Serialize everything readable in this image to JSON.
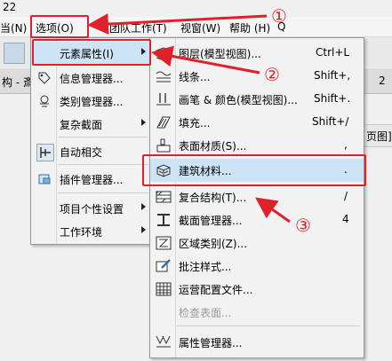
{
  "app": {
    "title_fragment": "22",
    "menubar": [
      {
        "label": "当(N)"
      },
      {
        "label": "选项(O)"
      },
      {
        "label": "团队工作(T)"
      },
      {
        "label": "视窗(W)"
      },
      {
        "label": "帮助 (H)"
      },
      {
        "label": "Q"
      }
    ],
    "tab_fragments": [
      "构 - 斎",
      "2"
    ],
    "right_pane_fragment": "页图]"
  },
  "options_menu": {
    "items": [
      {
        "label": "元素属性(I)",
        "icon": "element-properties-icon",
        "submenu": true,
        "highlighted": true
      },
      {
        "label": "信息管理器...",
        "icon": "tag-icon",
        "submenu": false
      },
      {
        "label": "类别管理器...",
        "icon": "layers-icon",
        "submenu": false
      },
      {
        "label": "复杂截面",
        "icon": "",
        "submenu": true
      },
      {
        "label": "自动相交",
        "icon": "intersect-icon",
        "submenu": false
      },
      {
        "label": "插件管理器...",
        "icon": "plugin-icon",
        "submenu": false
      },
      {
        "label": "项目个性设置",
        "icon": "",
        "submenu": true
      },
      {
        "label": "工作环境",
        "icon": "",
        "submenu": true
      }
    ]
  },
  "element_submenu": {
    "items": [
      {
        "label": "图层(模型视图)...",
        "shortcut": "Ctrl+L",
        "icon": "layers-stack-icon"
      },
      {
        "label": "线条...",
        "shortcut": "Shift+,",
        "icon": "line-type-icon"
      },
      {
        "label": "画笔 & 颜色(模型视图)...",
        "shortcut": "Shift+.",
        "icon": "pen-color-icon"
      },
      {
        "label": "填充...",
        "shortcut": "Shift+/",
        "icon": "fill-icon"
      },
      {
        "label": "表面材质(S)...",
        "shortcut": ",",
        "icon": "surface-icon"
      },
      {
        "label": "建筑材料...",
        "shortcut": ".",
        "icon": "building-material-icon",
        "highlighted": true
      },
      {
        "label": "复合结构(T)...",
        "shortcut": "/",
        "icon": "composite-icon"
      },
      {
        "label": "截面管理器...",
        "shortcut": "4",
        "icon": "profile-icon"
      },
      {
        "label": "区域类别(Z)...",
        "shortcut": "",
        "icon": "zone-icon"
      },
      {
        "label": "批注样式...",
        "shortcut": "",
        "icon": "markup-icon"
      },
      {
        "label": "运营配置文件...",
        "shortcut": "",
        "icon": "grid-icon"
      },
      {
        "label": "检查表面...",
        "shortcut": "",
        "icon": "",
        "disabled": true
      },
      {
        "label": "属性管理器...",
        "shortcut": "",
        "icon": "property-manager-icon"
      }
    ]
  },
  "annotations": {
    "step1": "①",
    "step2": "②",
    "step3": "③"
  },
  "colors": {
    "annotation_red": "#e0202a",
    "highlight": "#cde4f7",
    "menu_bg": "#f2f2f2"
  }
}
